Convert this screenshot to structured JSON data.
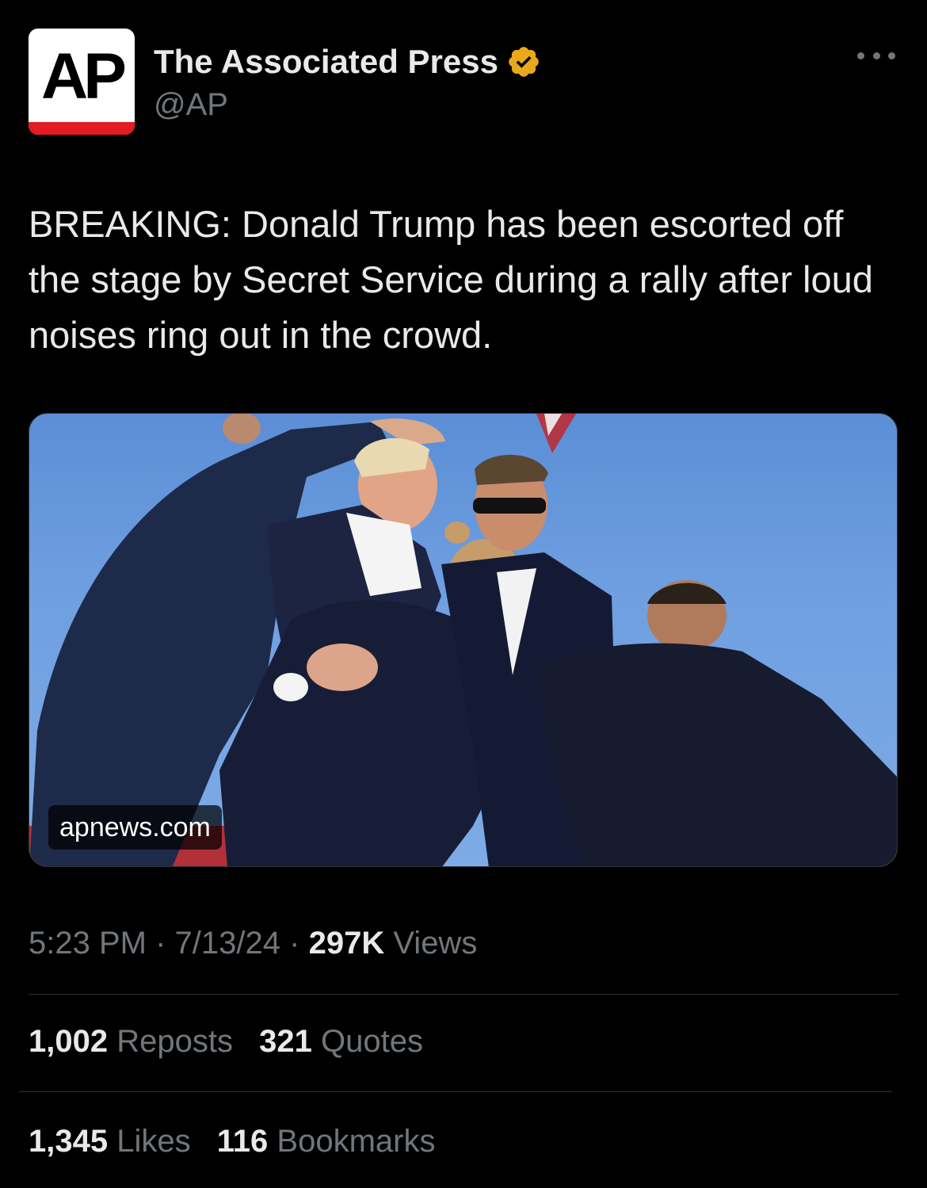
{
  "account": {
    "avatar_text": "AP",
    "display_name": "The Associated Press",
    "handle": "@AP",
    "verified_badge_color": "#e8a91c",
    "more_icon": "more-horizontal-icon"
  },
  "tweet": {
    "text": "BREAKING: Donald Trump has been escorted off the stage by Secret Service during a rally after loud noises ring out in the crowd.",
    "media": {
      "link_domain": "apnews.com"
    },
    "time": "5:23 PM",
    "date": "7/13/24",
    "separator": "·",
    "views_count": "297K",
    "views_label": "Views"
  },
  "stats": {
    "reposts_count": "1,002",
    "reposts_label": "Reposts",
    "quotes_count": "321",
    "quotes_label": "Quotes",
    "likes_count": "1,345",
    "likes_label": "Likes",
    "bookmarks_count": "116",
    "bookmarks_label": "Bookmarks"
  },
  "colors": {
    "background": "#000000",
    "primary_text": "#e7e9ea",
    "secondary_text": "#71767b",
    "divider": "#2f3336",
    "ap_red": "#e31b23"
  }
}
